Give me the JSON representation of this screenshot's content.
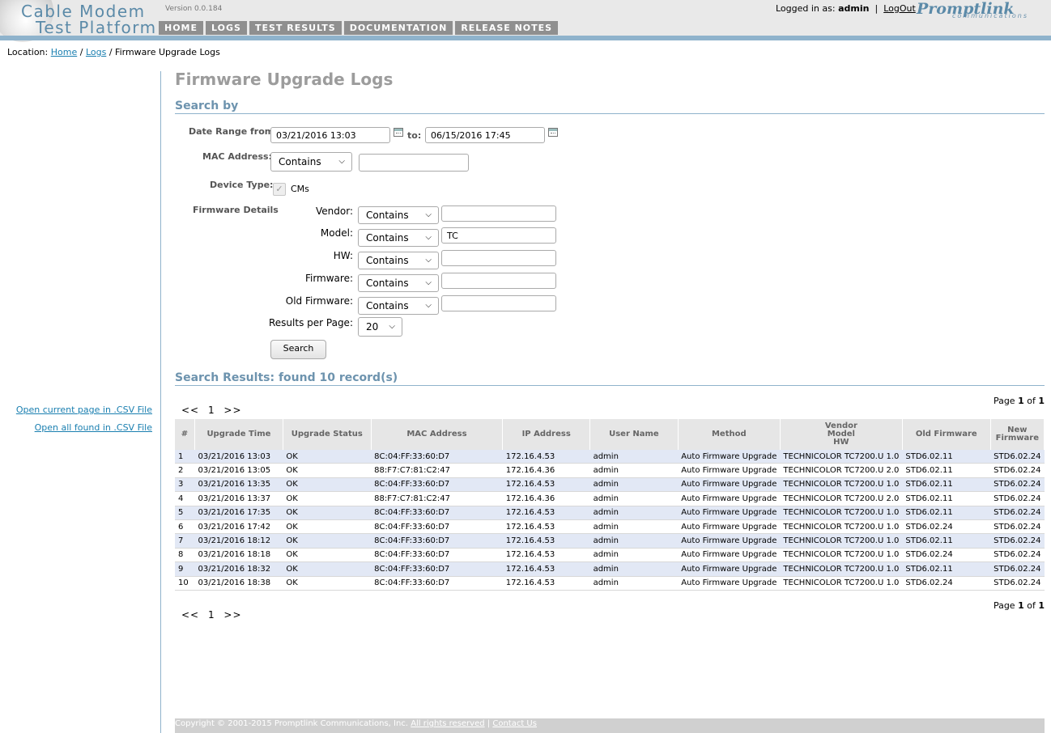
{
  "header": {
    "logo_line1": "Cable Modem",
    "logo_line2": "Test Platform",
    "version": "Version 0.0.184",
    "nav": [
      "HOME",
      "LOGS",
      "TEST RESULTS",
      "DOCUMENTATION",
      "RELEASE NOTES"
    ],
    "login_prefix": "Logged in as:",
    "user": "admin",
    "separator": "|",
    "logout": "LogOut",
    "brand": "Promptlink",
    "brand_sub": "communications"
  },
  "breadcrumb": {
    "prefix": "Location:",
    "home": "Home",
    "logs": "Logs",
    "sep": "/",
    "current": "Firmware Upgrade Logs"
  },
  "sidebar": {
    "csv_current": "Open current page in .CSV File",
    "csv_all": "Open all found in .CSV File"
  },
  "page_title": "Firmware Upgrade Logs",
  "search": {
    "heading": "Search by",
    "date_label": "Date Range from:",
    "date_from": "03/21/2016 13:03",
    "to_label": "to:",
    "date_to": "06/15/2016 17:45",
    "mac_label": "MAC Address:",
    "mac_op": "Contains",
    "mac_value": "",
    "device_label": "Device Type:",
    "device_cms": "CMs",
    "fw_details_label": "Firmware Details",
    "fields": [
      {
        "label": "Vendor:",
        "op": "Contains",
        "value": ""
      },
      {
        "label": "Model:",
        "op": "Contains",
        "value": "TC"
      },
      {
        "label": "HW:",
        "op": "Contains",
        "value": ""
      },
      {
        "label": "Firmware:",
        "op": "Contains",
        "value": ""
      },
      {
        "label": "Old Firmware:",
        "op": "Contains",
        "value": ""
      }
    ],
    "rpp_label": "Results per Page:",
    "rpp_value": "20",
    "search_button": "Search"
  },
  "results": {
    "heading": "Search Results: found 10 record(s)",
    "pager_prev": "<<",
    "pager_page": "1",
    "pager_next": ">>",
    "page_word": "Page",
    "page_current": "1",
    "of_word": "of",
    "page_total": "1",
    "columns": [
      "#",
      "Upgrade Time",
      "Upgrade Status",
      "MAC Address",
      "IP Address",
      "User Name",
      "Method",
      "Vendor",
      "Model",
      "HW",
      "Old Firmware",
      "New Firmware"
    ],
    "rows": [
      [
        "1",
        "03/21/2016 13:03",
        "OK",
        "8C:04:FF:33:60:D7",
        "172.16.4.53",
        "admin",
        "Auto Firmware Upgrade",
        "TECHNICOLOR TC7200.U 1.0",
        "STD6.02.11",
        "STD6.02.24"
      ],
      [
        "2",
        "03/21/2016 13:05",
        "OK",
        "88:F7:C7:81:C2:47",
        "172.16.4.36",
        "admin",
        "Auto Firmware Upgrade",
        "TECHNICOLOR TC7200.U 2.0",
        "STD6.02.11",
        "STD6.02.24"
      ],
      [
        "3",
        "03/21/2016 13:35",
        "OK",
        "8C:04:FF:33:60:D7",
        "172.16.4.53",
        "admin",
        "Auto Firmware Upgrade",
        "TECHNICOLOR TC7200.U 1.0",
        "STD6.02.11",
        "STD6.02.24"
      ],
      [
        "4",
        "03/21/2016 13:37",
        "OK",
        "88:F7:C7:81:C2:47",
        "172.16.4.36",
        "admin",
        "Auto Firmware Upgrade",
        "TECHNICOLOR TC7200.U 2.0",
        "STD6.02.11",
        "STD6.02.24"
      ],
      [
        "5",
        "03/21/2016 17:35",
        "OK",
        "8C:04:FF:33:60:D7",
        "172.16.4.53",
        "admin",
        "Auto Firmware Upgrade",
        "TECHNICOLOR TC7200.U 1.0",
        "STD6.02.11",
        "STD6.02.24"
      ],
      [
        "6",
        "03/21/2016 17:42",
        "OK",
        "8C:04:FF:33:60:D7",
        "172.16.4.53",
        "admin",
        "Auto Firmware Upgrade",
        "TECHNICOLOR TC7200.U 1.0",
        "STD6.02.24",
        "STD6.02.24"
      ],
      [
        "7",
        "03/21/2016 18:12",
        "OK",
        "8C:04:FF:33:60:D7",
        "172.16.4.53",
        "admin",
        "Auto Firmware Upgrade",
        "TECHNICOLOR TC7200.U 1.0",
        "STD6.02.11",
        "STD6.02.24"
      ],
      [
        "8",
        "03/21/2016 18:18",
        "OK",
        "8C:04:FF:33:60:D7",
        "172.16.4.53",
        "admin",
        "Auto Firmware Upgrade",
        "TECHNICOLOR TC7200.U 1.0",
        "STD6.02.24",
        "STD6.02.24"
      ],
      [
        "9",
        "03/21/2016 18:32",
        "OK",
        "8C:04:FF:33:60:D7",
        "172.16.4.53",
        "admin",
        "Auto Firmware Upgrade",
        "TECHNICOLOR TC7200.U 1.0",
        "STD6.02.11",
        "STD6.02.24"
      ],
      [
        "10",
        "03/21/2016 18:38",
        "OK",
        "8C:04:FF:33:60:D7",
        "172.16.4.53",
        "admin",
        "Auto Firmware Upgrade",
        "TECHNICOLOR TC7200.U 1.0",
        "STD6.02.24",
        "STD6.02.24"
      ]
    ]
  },
  "footer": {
    "copyright": "Copyright © 2001-2015 Promptlink Communications, Inc.",
    "rights": "All rights reserved",
    "sep": "|",
    "contact": "Contact Us"
  },
  "icons": {
    "calendar": "calendar-icon",
    "chevron": "chevron-down-icon",
    "checkbox": "checkmark-icon"
  },
  "colors": {
    "accent": "#6d93ae",
    "nav_tab": "#8f8f8f",
    "row_stripe": "#e2e8f5",
    "link": "#1a7fb0"
  }
}
